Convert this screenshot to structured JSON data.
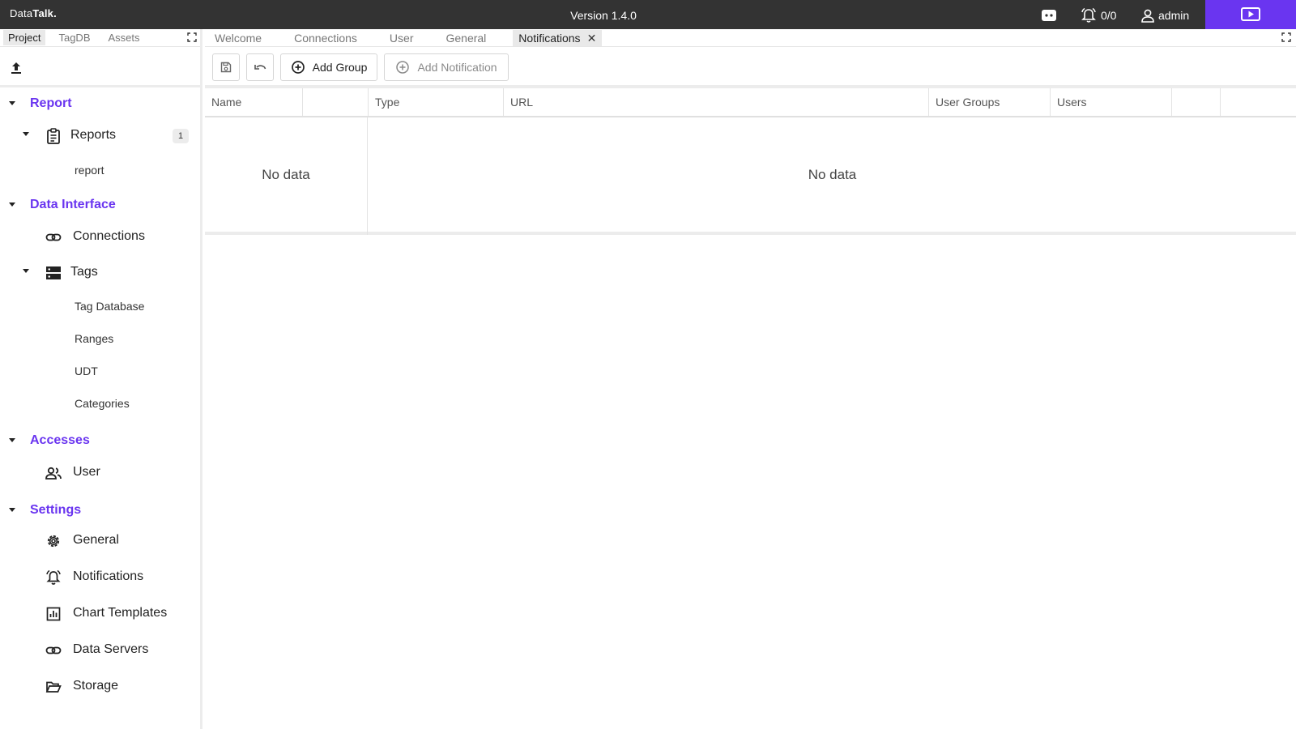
{
  "app": {
    "brand_prefix": "Data",
    "brand_suffix": "Talk.",
    "version": "Version 1.4.0",
    "alarm_count": "0/0",
    "user": "admin"
  },
  "left": {
    "tabs": [
      "Project",
      "TagDB",
      "Assets"
    ],
    "active_tab": "Project",
    "sections": {
      "report": "Report",
      "data_interface": "Data Interface",
      "accesses": "Accesses",
      "settings": "Settings"
    },
    "nodes": {
      "reports": "Reports",
      "reports_count": "1",
      "report_leaf": "report",
      "connections": "Connections",
      "tags": "Tags",
      "tag_database": "Tag Database",
      "ranges": "Ranges",
      "udt": "UDT",
      "categories": "Categories",
      "user": "User",
      "general": "General",
      "notifications": "Notifications",
      "chart_templates": "Chart Templates",
      "data_servers": "Data Servers",
      "storage": "Storage"
    }
  },
  "main": {
    "tabs": [
      "Welcome",
      "Connections",
      "User",
      "General",
      "Notifications"
    ],
    "active_tab": "Notifications",
    "toolbar": {
      "add_group": "Add Group",
      "add_notification": "Add Notification"
    },
    "grid": {
      "left_columns": [
        "Name",
        ""
      ],
      "right_columns": [
        "Type",
        "URL",
        "User Groups",
        "Users",
        "",
        ""
      ],
      "left_empty": "No data",
      "right_empty": "No data"
    }
  },
  "colors": {
    "accent": "#6a35f0",
    "topbar": "#333333"
  },
  "icons": {
    "chat": "chat-icon",
    "alarm": "alarm-bell-icon",
    "user": "user-icon",
    "present": "present-icon",
    "upload": "upload-icon",
    "save": "save-icon",
    "undo": "undo-icon",
    "add": "add-circle-icon"
  }
}
